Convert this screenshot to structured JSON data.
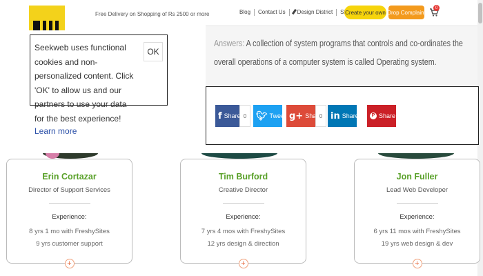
{
  "header": {
    "promo": "Free Delivery on Shopping of Rs 2500 or more",
    "nav": [
      "Blog",
      "Contact Us",
      "Design District",
      "Signup"
    ],
    "create_button": "Create your own",
    "complaint_button": "Drop Complaint",
    "cart_count": "0"
  },
  "answer": {
    "label": "Answers:",
    "text": "A collection of system programs that controls and co-ordinates the overall operations of a computer system is called Operating system."
  },
  "share": {
    "facebook": {
      "label": "Share",
      "count": "0"
    },
    "twitter": {
      "label": "Tweet"
    },
    "google": {
      "label": "Share",
      "count": "0"
    },
    "linkedin": {
      "label": "Share"
    },
    "pinterest": {
      "label": "Share"
    }
  },
  "cookie": {
    "text": "Seekweb uses functional cookies and non-personalized content. Click 'OK' to allow us and our partners to use your data for the best experience!",
    "learn_more": "Learn more",
    "ok": "OK"
  },
  "team": [
    {
      "name": "Erin Cortazar",
      "role": "Director of Support Services",
      "experience_heading": "Experience:",
      "exp1": "8 yrs 1 mo with FreshySites",
      "exp2": "9 yrs customer support"
    },
    {
      "name": "Tim Burford",
      "role": "Creative Director",
      "experience_heading": "Experience:",
      "exp1": "7 yrs 4 mos with FreshySites",
      "exp2": "12 yrs design & direction"
    },
    {
      "name": "Jon Fuller",
      "role": "Lead Web Developer",
      "experience_heading": "Experience:",
      "exp1": "6 yrs 11 mos with FreshySites",
      "exp2": "19 yrs web design & dev"
    }
  ],
  "colors": {
    "accent_yellow": "#f6d40c",
    "accent_orange": "#f39a1d",
    "name_green": "#5aa12a"
  }
}
